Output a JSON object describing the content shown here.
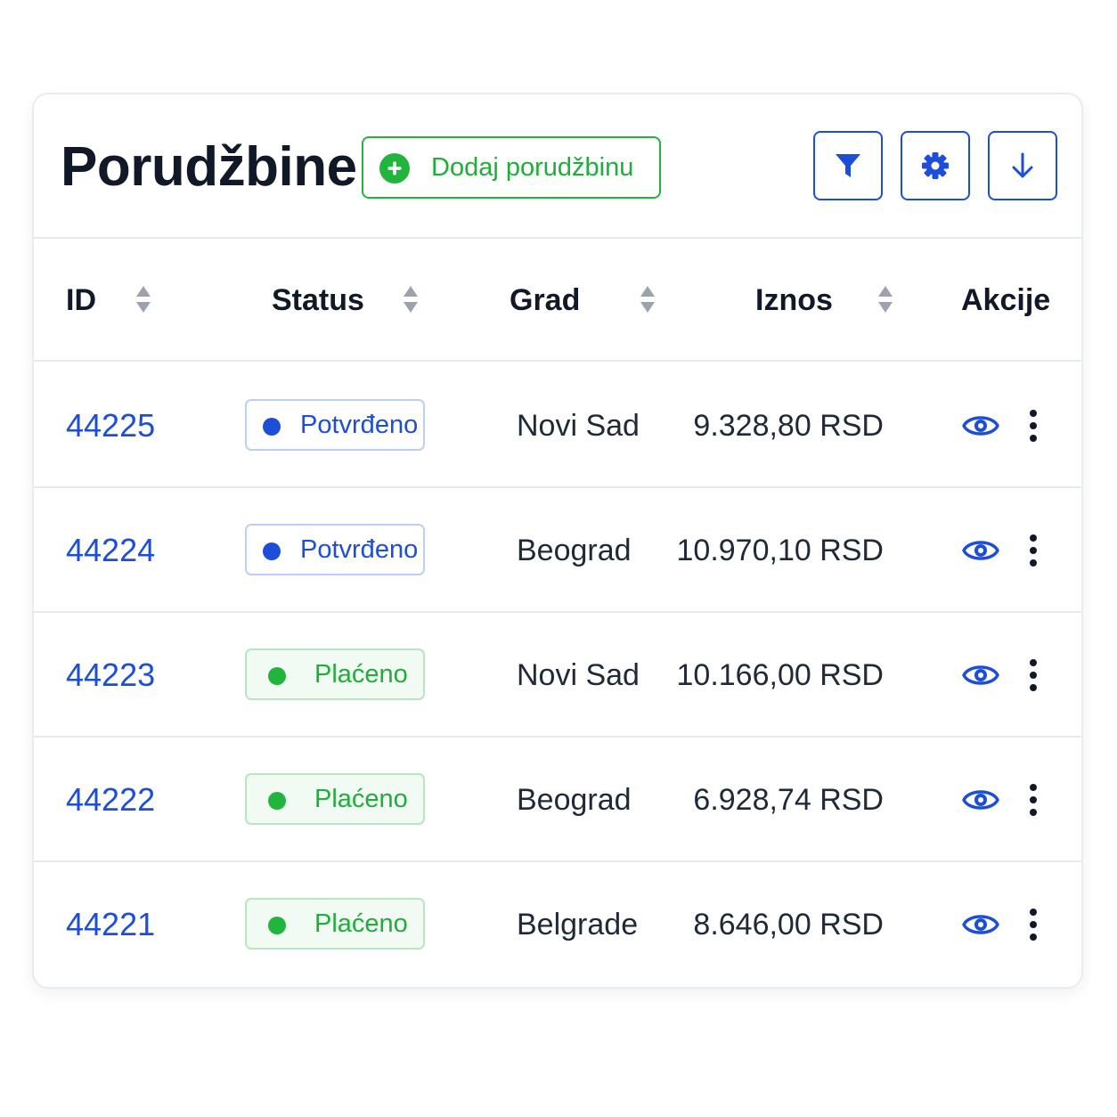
{
  "header": {
    "title": "Porudžbine",
    "add_button_label": "Dodaj porudžbinu",
    "toolbar": [
      {
        "icon": "filter-icon"
      },
      {
        "icon": "gear-icon"
      },
      {
        "icon": "download-icon"
      }
    ]
  },
  "colors": {
    "primary_blue": "#1d4ed8",
    "green": "#22b53e",
    "text_dark": "#111827",
    "border": "#e6e9ee"
  },
  "table": {
    "columns": [
      {
        "label": "ID",
        "sortable": true
      },
      {
        "label": "Status",
        "sortable": true
      },
      {
        "label": "Grad",
        "sortable": true
      },
      {
        "label": "Iznos",
        "sortable": true
      },
      {
        "label": "Akcije",
        "sortable": false
      }
    ],
    "rows": [
      {
        "id": "44225",
        "status": "Potvrđeno",
        "status_type": "confirmed",
        "city": "Novi Sad",
        "amount": "9.328,80 RSD"
      },
      {
        "id": "44224",
        "status": "Potvrđeno",
        "status_type": "confirmed",
        "city": "Beograd",
        "amount": "10.970,10 RSD"
      },
      {
        "id": "44223",
        "status": "Plaćeno",
        "status_type": "paid",
        "city": "Novi Sad",
        "amount": "10.166,00 RSD"
      },
      {
        "id": "44222",
        "status": "Plaćeno",
        "status_type": "paid",
        "city": "Beograd",
        "amount": "6.928,74 RSD"
      },
      {
        "id": "44221",
        "status": "Plaćeno",
        "status_type": "paid",
        "city": "Belgrade",
        "amount": "8.646,00 RSD"
      }
    ],
    "row_actions": [
      "eye-icon",
      "more-vertical-icon"
    ]
  }
}
